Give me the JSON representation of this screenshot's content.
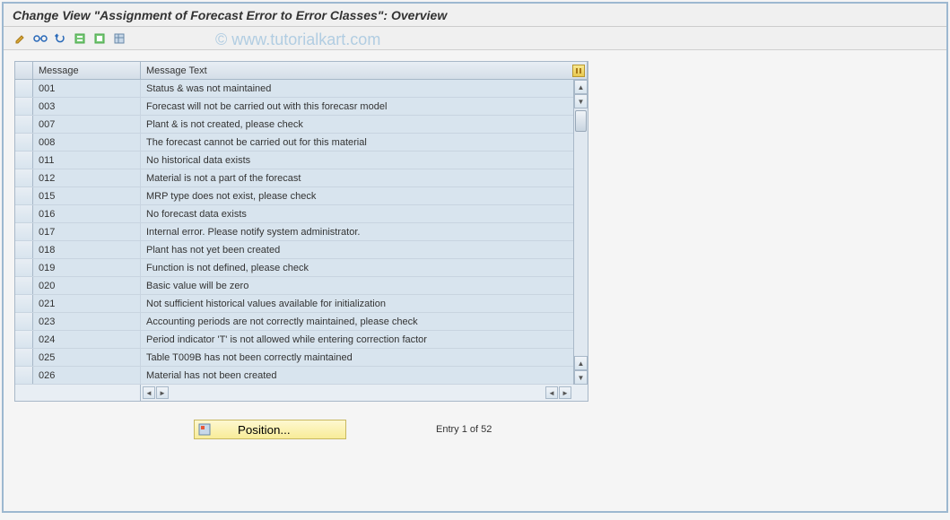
{
  "header": {
    "title": "Change View \"Assignment of Forecast Error to Error Classes\": Overview"
  },
  "watermark": "© www.tutorialkart.com",
  "toolbar": {
    "icons": [
      "change-icon",
      "glasses-icon",
      "undo-icon",
      "select-all-icon",
      "deselect-icon",
      "config-icon"
    ]
  },
  "table": {
    "headers": {
      "message": "Message",
      "message_text": "Message Text"
    },
    "rows": [
      {
        "msg": "001",
        "text": "Status & was not maintained"
      },
      {
        "msg": "003",
        "text": "Forecast will not be carried out with this forecasr model"
      },
      {
        "msg": "007",
        "text": "Plant & is not created, please check"
      },
      {
        "msg": "008",
        "text": "The forecast cannot be carried out for this material"
      },
      {
        "msg": "011",
        "text": "No historical data exists"
      },
      {
        "msg": "012",
        "text": "Material is not a part of the forecast"
      },
      {
        "msg": "015",
        "text": "MRP type does not exist, please check"
      },
      {
        "msg": "016",
        "text": "No forecast data exists"
      },
      {
        "msg": "017",
        "text": "Internal error. Please notify system administrator."
      },
      {
        "msg": "018",
        "text": "Plant has not yet been created"
      },
      {
        "msg": "019",
        "text": "Function is not defined, please check"
      },
      {
        "msg": "020",
        "text": "Basic value will be zero"
      },
      {
        "msg": "021",
        "text": "Not sufficient historical values available for initialization"
      },
      {
        "msg": "023",
        "text": "Accounting periods are not correctly maintained, please check"
      },
      {
        "msg": "024",
        "text": "Period indicator 'T' is not allowed while entering correction factor"
      },
      {
        "msg": "025",
        "text": "Table T009B has not been correctly maintained"
      },
      {
        "msg": "026",
        "text": "Material has not been created"
      }
    ]
  },
  "footer": {
    "position_label": "Position...",
    "entry_text": "Entry 1 of 52"
  }
}
